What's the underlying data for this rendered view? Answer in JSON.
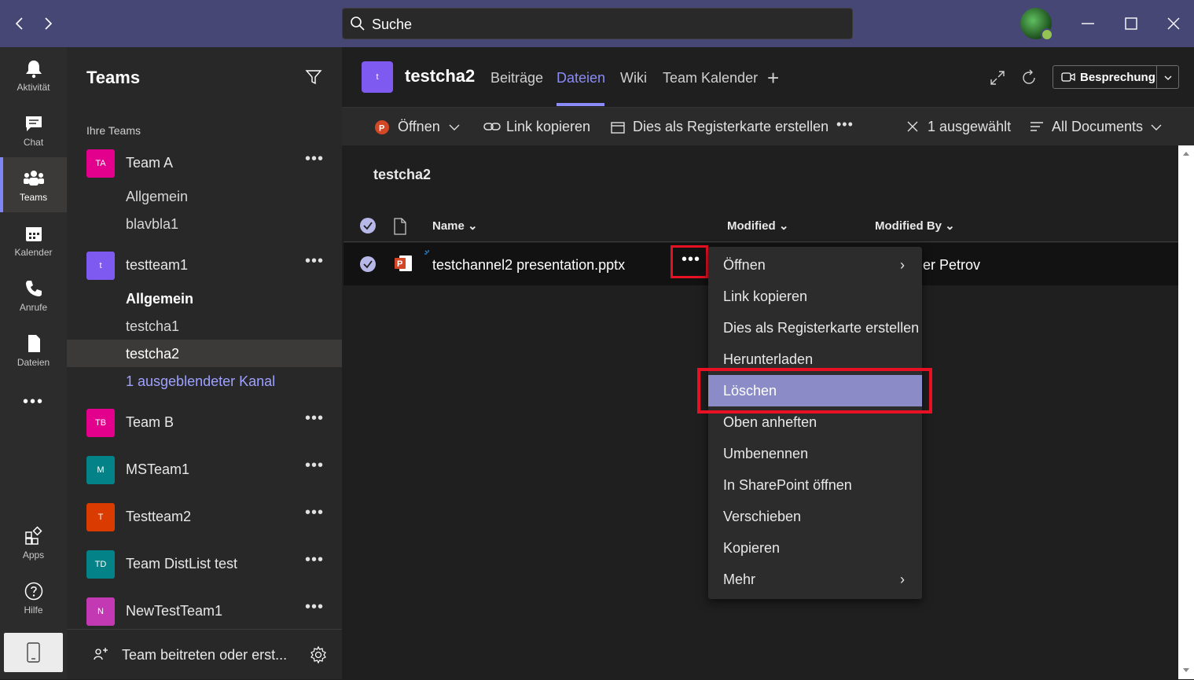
{
  "titlebar": {
    "search_placeholder": "Suche"
  },
  "rail": {
    "items": [
      {
        "label": "Aktivität",
        "icon": "bell-icon"
      },
      {
        "label": "Chat",
        "icon": "chat-icon"
      },
      {
        "label": "Teams",
        "icon": "teams-icon"
      },
      {
        "label": "Kalender",
        "icon": "calendar-icon"
      },
      {
        "label": "Anrufe",
        "icon": "phone-icon"
      },
      {
        "label": "Dateien",
        "icon": "file-icon"
      }
    ],
    "more": "•••",
    "apps": "Apps",
    "help": "Hilfe"
  },
  "sidebar": {
    "title": "Teams",
    "section_label": "Ihre Teams",
    "teams": [
      {
        "initials": "TA",
        "name": "Team A",
        "color": "#e3008c"
      },
      {
        "initials": "t",
        "name": "testteam1",
        "color": "#7f5af0"
      },
      {
        "initials": "TB",
        "name": "Team B",
        "color": "#e3008c"
      },
      {
        "initials": "M",
        "name": "MSTeam1",
        "color": "#038387"
      },
      {
        "initials": "T",
        "name": "Testteam2",
        "color": "#da3b01"
      },
      {
        "initials": "TD",
        "name": "Team DistList test",
        "color": "#038387"
      },
      {
        "initials": "N",
        "name": "NewTestTeam1",
        "color": "#c239b3"
      }
    ],
    "channels_team_a": [
      "Allgemein",
      "blavbla1"
    ],
    "channels_testteam1": [
      "Allgemein",
      "testcha1",
      "testcha2"
    ],
    "hidden_channels": "1 ausgeblendeter Kanal",
    "join_label": "Team beitreten oder erst...",
    "more_dots": "•••"
  },
  "header": {
    "channel_initial": "t",
    "channel_name": "testcha2",
    "tabs": [
      "Beiträge",
      "Dateien",
      "Wiki",
      "Team Kalender"
    ],
    "add_tab": "+",
    "meeting_label": "Besprechung"
  },
  "commandbar": {
    "open": "Öffnen",
    "copy_link": "Link kopieren",
    "make_tab": "Dies als Registerkarte erstellen",
    "more": "•••",
    "selected": "1 ausgewählt",
    "view": "All Documents"
  },
  "files": {
    "breadcrumb": "testcha2",
    "columns": {
      "name": "Name",
      "modified": "Modified",
      "modified_by": "Modified By"
    },
    "rows": [
      {
        "name": "testchannel2 presentation.pptx",
        "modified_by": "er Petrov"
      }
    ],
    "row_more": "•••"
  },
  "context_menu": {
    "items": [
      "Öffnen",
      "Link kopieren",
      "Dies als Registerkarte erstellen",
      "Herunterladen",
      "Löschen",
      "Oben anheften",
      "Umbenennen",
      "In SharePoint öffnen",
      "Verschieben",
      "Kopieren",
      "Mehr"
    ],
    "highlighted": "Löschen",
    "submenu_chevron": "›"
  },
  "colors": {
    "accent": "#8b8cf7",
    "titlebar": "#464775",
    "highlight_box": "#e81123"
  }
}
